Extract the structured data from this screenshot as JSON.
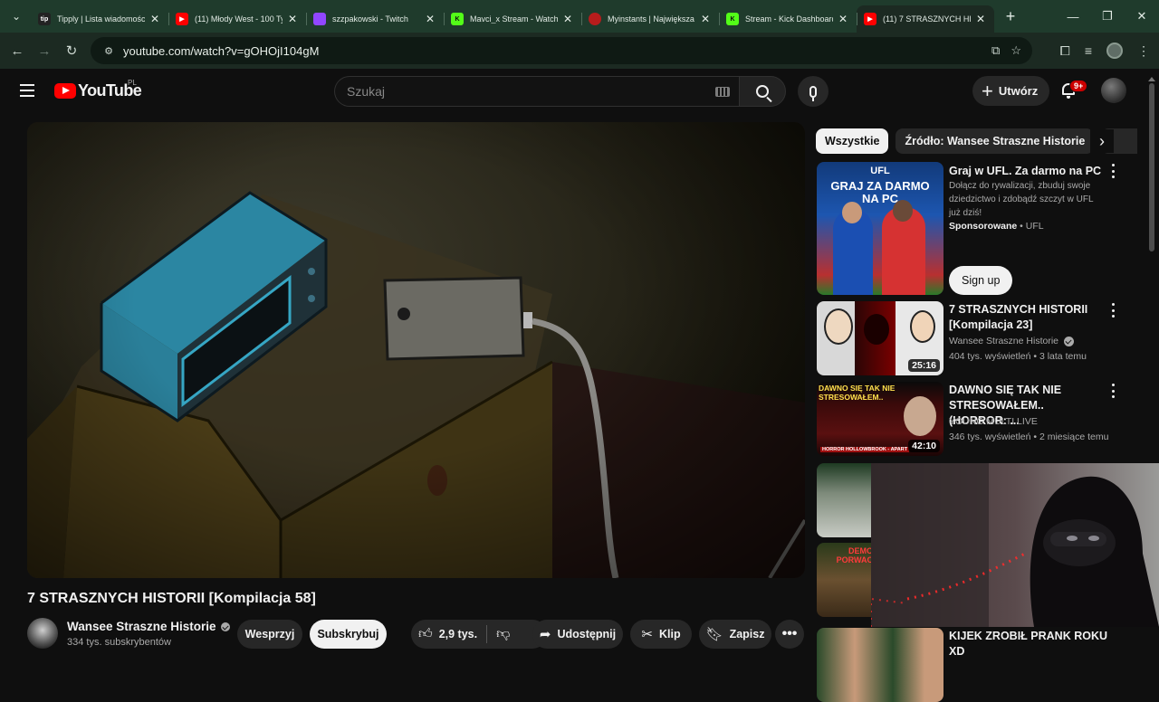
{
  "browser": {
    "tabs": [
      {
        "title": "Tipply | Lista wiadomości",
        "fav_color": "#222222",
        "fav_text": "tip"
      },
      {
        "title": "(11) Młody West - 100 Ty",
        "fav_color": "#ff0000",
        "fav_text": ""
      },
      {
        "title": "szzpakowski - Twitch",
        "fav_color": "#9146ff",
        "fav_text": ""
      },
      {
        "title": "Mavci_x Stream - Watch I",
        "fav_color": "#53fc18",
        "fav_text": "K"
      },
      {
        "title": "Myinstants | Największa",
        "fav_color": "#b71c1c",
        "fav_text": ""
      },
      {
        "title": "Stream - Kick Dashboard",
        "fav_color": "#53fc18",
        "fav_text": "K"
      },
      {
        "title": "(11) 7 STRASZNYCH HIST",
        "fav_color": "#ff0000",
        "fav_text": ""
      }
    ],
    "url": "youtube.com/watch?v=gOHOjI104gM"
  },
  "masthead": {
    "logo": "YouTube",
    "country": "PL",
    "search_placeholder": "Szukaj",
    "create_label": "Utwórz",
    "notification_badge": "9+"
  },
  "video": {
    "title": "7 STRASZNYCH HISTORII [Kompilacja 58]",
    "channel": "Wansee Straszne Historie",
    "subscribers": "334 tys. subskrybentów",
    "support_label": "Wesprzyj",
    "subscribe_label": "Subskrybuj",
    "likes": "2,9 tys.",
    "share_label": "Udostępnij",
    "clip_label": "Klip",
    "save_label": "Zapisz"
  },
  "chips": [
    "Wszystkie",
    "Źródło: Wansee Straszne Historie"
  ],
  "ad": {
    "title": "Graj w UFL. Za darmo na PC",
    "description": "Dołącz do rywalizacji, zbuduj swoje dziedzictwo i zdobądź szczyt w UFL już dziś!",
    "sponsored": "Sponsorowane",
    "advertiser": "UFL",
    "cta": "Sign up",
    "thumb_logo": "UFL",
    "thumb_text": "GRAJ ZA DARMO NA PC"
  },
  "recommendations": [
    {
      "title": "7 STRASZNYCH HISTORII [Kompilacja 23]",
      "channel": "Wansee Straszne Historie",
      "verified": true,
      "meta": "404 tys. wyświetleń • 3 lata temu",
      "duration": "25:16"
    },
    {
      "title": "DAWNO SIĘ TAK NIE STRESOWAŁEM.. (HORROR: ...",
      "channel": "YOUNG MULTI LIVE",
      "verified": false,
      "meta": "346 tys. wyświetleń • 2 miesiące temu",
      "duration": "42:10",
      "thumb_text": "DAWNO SIĘ TAK NIE STRESOWAŁEM..",
      "thumb_sub": "HORROR HOLLOWBROOK - APART"
    },
    {
      "title": "",
      "channel": "",
      "meta": "",
      "duration": ""
    },
    {
      "title": "",
      "channel": "",
      "meta": "",
      "duration": "",
      "thumb_text": "DEMO PORWAC"
    },
    {
      "title": "KIJEK ZROBIŁ PRANK ROKU XD",
      "channel": "",
      "meta": "",
      "duration": ""
    }
  ]
}
